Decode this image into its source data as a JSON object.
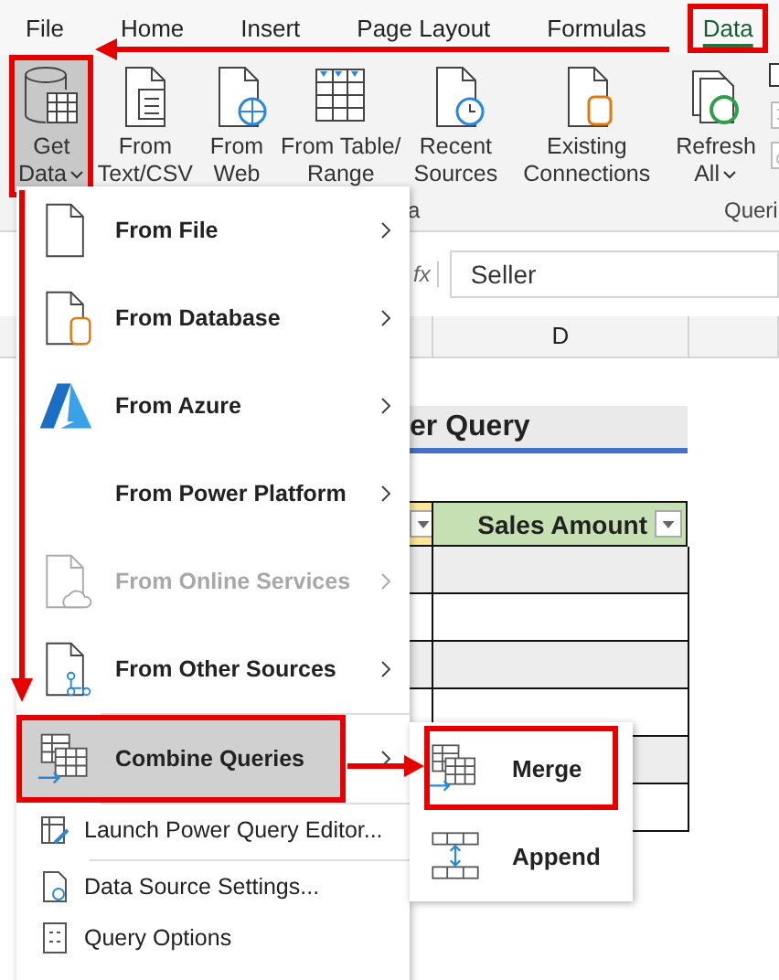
{
  "ribbon_tabs": [
    {
      "label": "File",
      "selected": false,
      "marked": false
    },
    {
      "label": "Home",
      "selected": false,
      "marked": false
    },
    {
      "label": "Insert",
      "selected": false,
      "marked": false
    },
    {
      "label": "Page Layout",
      "selected": false,
      "marked": false
    },
    {
      "label": "Formulas",
      "selected": false,
      "marked": false
    },
    {
      "label": "Data",
      "selected": true,
      "marked": true
    }
  ],
  "ribbon_buttons": [
    {
      "lines": [
        "Get",
        "Data"
      ],
      "dropdown": true,
      "pressed": true,
      "marked": true
    },
    {
      "lines": [
        "From",
        "Text/CSV"
      ],
      "dropdown": false,
      "pressed": false,
      "marked": false
    },
    {
      "lines": [
        "From",
        "Web"
      ],
      "dropdown": false,
      "pressed": false,
      "marked": false
    },
    {
      "lines": [
        "From Table/",
        "Range"
      ],
      "dropdown": false,
      "pressed": false,
      "marked": false
    },
    {
      "lines": [
        "Recent",
        "Sources"
      ],
      "dropdown": false,
      "pressed": false,
      "marked": false
    },
    {
      "lines": [
        "Existing",
        "Connections"
      ],
      "dropdown": false,
      "pressed": false,
      "marked": false
    },
    {
      "lines": [
        "Refresh",
        "All"
      ],
      "dropdown": true,
      "pressed": false,
      "marked": false
    }
  ],
  "group_labels": [
    "a",
    "Queri"
  ],
  "formula_bar": {
    "function_label": "fx",
    "value": "Seller"
  },
  "column_header": "D",
  "sheet": {
    "title": "er Query",
    "header": "Sales Amount"
  },
  "menu": {
    "items": [
      {
        "label": "From File",
        "submenu": true,
        "disabled": false,
        "highlighted": false,
        "marked": false
      },
      {
        "label": "From Database",
        "submenu": true,
        "disabled": false,
        "highlighted": false,
        "marked": false
      },
      {
        "label": "From Azure",
        "submenu": true,
        "disabled": false,
        "highlighted": false,
        "marked": false
      },
      {
        "label": "From Power Platform",
        "submenu": true,
        "disabled": false,
        "highlighted": false,
        "marked": false
      },
      {
        "label": "From Online Services",
        "submenu": true,
        "disabled": true,
        "highlighted": false,
        "marked": false
      },
      {
        "label": "From Other Sources",
        "submenu": true,
        "disabled": false,
        "highlighted": false,
        "marked": false
      },
      {
        "label": "Combine Queries",
        "submenu": true,
        "disabled": false,
        "highlighted": true,
        "marked": true
      }
    ],
    "commands": [
      {
        "label": "Launch Power Query Editor..."
      },
      {
        "label": "Data Source Settings..."
      },
      {
        "label": "Query Options"
      }
    ]
  },
  "submenu": {
    "items": [
      {
        "label": "Merge",
        "marked": true
      },
      {
        "label": "Append",
        "marked": false
      }
    ]
  }
}
